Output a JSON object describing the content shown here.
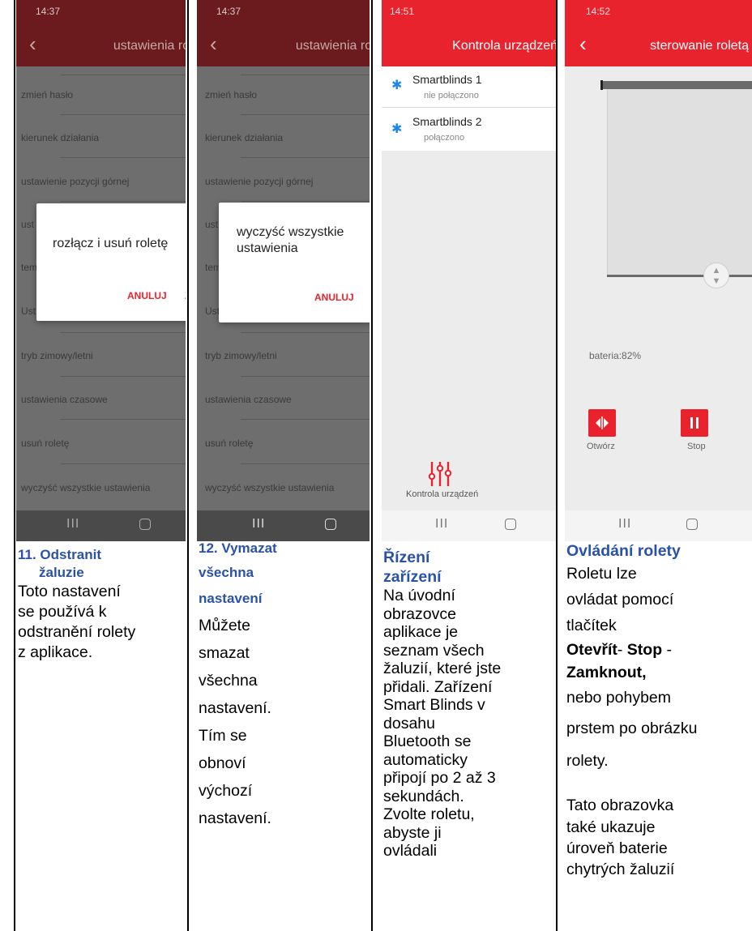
{
  "panel1": {
    "time": "14:37",
    "title": "ustawienia rolety",
    "settings": [
      "zmień hasło",
      "kierunek działania",
      "ustawienie pozycji górnej",
      "ust",
      "tem",
      "Ust",
      "tryb zimowy/letni",
      "ustawienia czasowe",
      "usuń roletę",
      "wyczyść wszystkie ustawienia"
    ],
    "dialog_text": "rozłącz i usuń roletę",
    "dialog_cancel": "ANULUJ",
    "dialog_ok_partial": "Z",
    "nav_bars": "III"
  },
  "panel2": {
    "time": "14:37",
    "title": "ustawienia rolety",
    "settings": [
      "zmień hasło",
      "kierunek działania",
      "ustawienie pozycji górnej",
      "ust",
      "tem",
      "Ust",
      "tryb zimowy/letni",
      "ustawienia czasowe",
      "usuń roletę",
      "wyczyść wszystkie ustawienia"
    ],
    "dialog_text_1": "wyczyść wszystkie",
    "dialog_text_2": "ustawienia",
    "dialog_cancel": "ANULUJ",
    "nav_bars": "III"
  },
  "panel3": {
    "time": "14:51",
    "title": "Kontrola urządzeń",
    "devices": [
      {
        "name": "Smartblinds 1",
        "status": "nie połączono"
      },
      {
        "name": "Smartblinds 2",
        "status": "połączono"
      }
    ],
    "bottom_label": "Kontrola urządzeń",
    "nav_bars": "III"
  },
  "panel4": {
    "time": "14:52",
    "title": "sterowanie roletą",
    "battery_label": "bateria:82%",
    "open_label": "Otwórz",
    "stop_label": "Stop",
    "nav_bars": "III"
  },
  "captions": {
    "c1": {
      "heading_1": "11. Odstranit",
      "heading_2": "žaluzie",
      "body": [
        "Toto nastavení",
        "se používá k",
        "odstranění rolety",
        "z aplikace."
      ]
    },
    "c2": {
      "heading": [
        "12. Vymazat",
        "všechna",
        "nastavení"
      ],
      "body": [
        "Můžete",
        "smazat",
        "všechna",
        "nastavení.",
        "Tím se",
        "obnoví",
        "výchozí",
        "nastavení."
      ]
    },
    "c3": {
      "heading": [
        "Řízení",
        "zařízení"
      ],
      "body": [
        "Na úvodní",
        "obrazovce",
        "aplikace je",
        "seznam všech",
        "žaluzií, které jste",
        "přidali. Zařízení",
        "Smart Blinds v",
        "dosahu",
        "Bluetooth se",
        "automaticky",
        "připojí po 2 až 3",
        "sekundách.",
        "Zvolte roletu,",
        "abyste ji",
        "ovládali"
      ]
    },
    "c4": {
      "heading": "Ovládání rolety",
      "body_1": [
        "Roletu lze",
        "ovládat pomocí",
        "tlačítek"
      ],
      "bold_open": "Otevřít",
      "dash_1": "- ",
      "bold_stop": "Stop",
      "dash_2": " -",
      "bold_close": "Zamknout,",
      "body_2": [
        "nebo pohybem",
        "prstem po obrázku",
        "rolety."
      ],
      "body_3": [
        "Tato obrazovka",
        "také ukazuje",
        "úroveň baterie",
        "chytrých žaluzií"
      ]
    }
  },
  "colors": {
    "brand_red": "#e8232e",
    "dark_red": "#6b1a1d",
    "heading_blue": "#2a52a8",
    "dim_grey": "#6e6e6e"
  }
}
